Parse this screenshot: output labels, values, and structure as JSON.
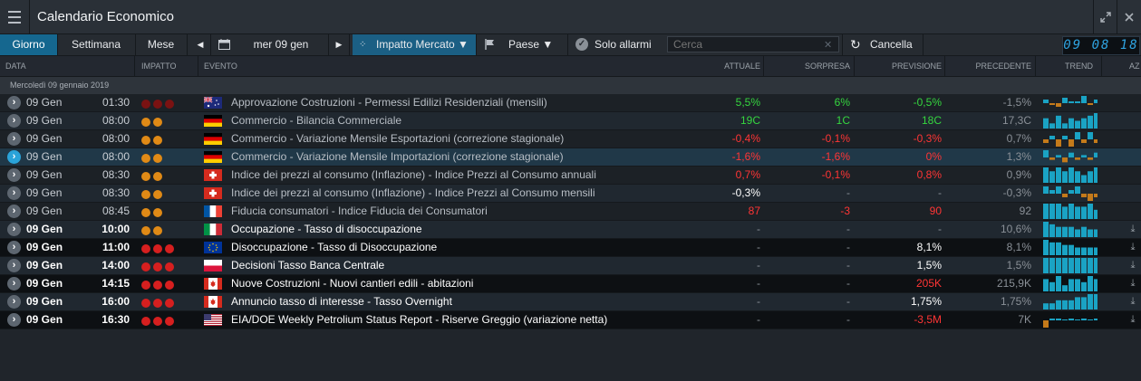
{
  "app": {
    "title": "Calendario Economico",
    "expand_icon": "expand-icon",
    "close_icon": "close-icon"
  },
  "toolbar": {
    "tab_day": "Giorno",
    "tab_week": "Settimana",
    "tab_month": "Mese",
    "date": "mer 09 gen",
    "impact_filter": "Impatto Mercato ▼",
    "country_filter": "Paese ▼",
    "alarms_only": "Solo allarmi",
    "search_placeholder": "Cerca",
    "clear": "Cancella",
    "clock": "09 08 18"
  },
  "headers": {
    "data": "DATA",
    "impatto": "IMPATTO",
    "evento": "EVENTO",
    "attuale": "ATTUALE",
    "sorpresa": "SORPRESA",
    "previsione": "PREVISIONE",
    "precedente": "PRECEDENTE",
    "trend": "TREND",
    "az": "AZ"
  },
  "date_group": "Mercoledì 09 gennaio 2019",
  "colors": {
    "accent": "#15678f",
    "impact_red": "#d61f1f",
    "impact_dark_red": "#7a1212",
    "impact_orange": "#e08a16",
    "positive": "#35d63f",
    "negative": "#ff3535",
    "trend_blue": "#1aa3c4",
    "trend_orange": "#c47a1a"
  },
  "events": [
    {
      "date": "09 Gen",
      "time": "01:30",
      "impact": 3,
      "impact_style": "dark",
      "flag": "australia",
      "event": "Approvazione Costruzioni - Permessi Edilizi Residenziali (mensili)",
      "actual": "5,5%",
      "actual_color": "green",
      "surprise": "6%",
      "surprise_color": "green",
      "forecast": "-0,5%",
      "forecast_color": "green",
      "previous": "-1,5%",
      "bars": [
        2,
        -1,
        -2,
        3,
        1,
        1,
        4,
        -1,
        2
      ],
      "style": "odd",
      "bold": false
    },
    {
      "date": "09 Gen",
      "time": "08:00",
      "impact": 2,
      "impact_style": "orange",
      "flag": "germany",
      "event": "Commercio - Bilancia Commerciale",
      "actual": "19C",
      "actual_color": "green",
      "surprise": "1C",
      "surprise_color": "green",
      "forecast": "18C",
      "forecast_color": "green",
      "previous": "17,3C",
      "bars": [
        4,
        2,
        5,
        2,
        4,
        3,
        4,
        5,
        6
      ],
      "style": "even",
      "bold": false
    },
    {
      "date": "09 Gen",
      "time": "08:00",
      "impact": 2,
      "impact_style": "orange",
      "flag": "germany",
      "event": "Commercio - Variazione Mensile Esportazioni (correzione stagionale)",
      "actual": "-0,4%",
      "actual_color": "red",
      "surprise": "-0,1%",
      "surprise_color": "red",
      "forecast": "-0,3%",
      "forecast_color": "red",
      "previous": "0,7%",
      "bars": [
        -1,
        1,
        -2,
        1,
        -2,
        2,
        -1,
        2,
        -1
      ],
      "style": "odd",
      "bold": false
    },
    {
      "date": "09 Gen",
      "time": "08:00",
      "impact": 2,
      "impact_style": "orange",
      "flag": "germany",
      "event": "Commercio - Variazione Mensile Importazioni (correzione stagionale)",
      "actual": "-1,6%",
      "actual_color": "red",
      "surprise": "-1,6%",
      "surprise_color": "red",
      "forecast": "0%",
      "forecast_color": "red",
      "previous": "1,3%",
      "bars": [
        3,
        -1,
        1,
        -2,
        2,
        -1,
        1,
        -1,
        2
      ],
      "style": "hl",
      "bold": false
    },
    {
      "date": "09 Gen",
      "time": "08:30",
      "impact": 2,
      "impact_style": "orange",
      "flag": "switzerland",
      "event": "Indice dei prezzi al consumo (Inflazione) - Indice Prezzi al Consumo annuali",
      "actual": "0,7%",
      "actual_color": "red",
      "surprise": "-0,1%",
      "surprise_color": "red",
      "forecast": "0,8%",
      "forecast_color": "red",
      "previous": "0,9%",
      "bars": [
        4,
        3,
        4,
        3,
        4,
        3,
        2,
        3,
        4
      ],
      "style": "odd",
      "bold": false
    },
    {
      "date": "09 Gen",
      "time": "08:30",
      "impact": 2,
      "impact_style": "orange",
      "flag": "switzerland",
      "event": "Indice dei prezzi al consumo (Inflazione) - Indice Prezzi al Consumo mensili",
      "actual": "-0,3%",
      "actual_color": "white",
      "surprise": "-",
      "surprise_color": "grey",
      "forecast": "-",
      "forecast_color": "grey",
      "previous": "-0,3%",
      "bars": [
        2,
        1,
        2,
        -1,
        1,
        2,
        -1,
        -2,
        -1
      ],
      "style": "even",
      "bold": false
    },
    {
      "date": "09 Gen",
      "time": "08:45",
      "impact": 2,
      "impact_style": "orange",
      "flag": "france",
      "event": "Fiducia consumatori - Indice Fiducia dei Consumatori",
      "actual": "87",
      "actual_color": "red",
      "surprise": "-3",
      "surprise_color": "red",
      "forecast": "90",
      "forecast_color": "red",
      "previous": "92",
      "bars": [
        5,
        5,
        5,
        4,
        5,
        4,
        4,
        5,
        3
      ],
      "style": "odd",
      "bold": false
    },
    {
      "date": "09 Gen",
      "time": "10:00",
      "impact": 2,
      "impact_style": "orange",
      "flag": "italy",
      "event": "Occupazione - Tasso di disoccupazione",
      "actual": "-",
      "actual_color": "grey",
      "surprise": "-",
      "surprise_color": "grey",
      "forecast": "-",
      "forecast_color": "grey",
      "previous": "10,6%",
      "bars": [
        6,
        5,
        4,
        4,
        4,
        3,
        4,
        3,
        3
      ],
      "style": "even",
      "bold": true
    },
    {
      "date": "09 Gen",
      "time": "11:00",
      "impact": 3,
      "impact_style": "red",
      "flag": "eu",
      "event": "Disoccupazione - Tasso di Disoccupazione",
      "actual": "-",
      "actual_color": "grey",
      "surprise": "-",
      "surprise_color": "grey",
      "forecast": "8,1%",
      "forecast_color": "white",
      "previous": "8,1%",
      "bars": [
        6,
        5,
        5,
        4,
        4,
        3,
        3,
        3,
        3
      ],
      "style": "black",
      "bold": true
    },
    {
      "date": "09 Gen",
      "time": "14:00",
      "impact": 3,
      "impact_style": "red",
      "flag": "poland",
      "event": "Decisioni Tasso Banca Centrale",
      "actual": "-",
      "actual_color": "grey",
      "surprise": "-",
      "surprise_color": "grey",
      "forecast": "1,5%",
      "forecast_color": "white",
      "previous": "1,5%",
      "bars": [
        1,
        1,
        1,
        1,
        1,
        1,
        1,
        1,
        1
      ],
      "style": "even",
      "bold": true
    },
    {
      "date": "09 Gen",
      "time": "14:15",
      "impact": 3,
      "impact_style": "red",
      "flag": "canada",
      "event": "Nuove Costruzioni - Nuovi cantieri edili - abitazioni",
      "actual": "-",
      "actual_color": "grey",
      "surprise": "-",
      "surprise_color": "grey",
      "forecast": "205K",
      "forecast_color": "red",
      "previous": "215,9K",
      "bars": [
        4,
        3,
        5,
        2,
        4,
        4,
        3,
        5,
        4
      ],
      "style": "black",
      "bold": true
    },
    {
      "date": "09 Gen",
      "time": "16:00",
      "impact": 3,
      "impact_style": "red",
      "flag": "canada",
      "event": "Annuncio tasso di interesse - Tasso Overnight",
      "actual": "-",
      "actual_color": "grey",
      "surprise": "-",
      "surprise_color": "grey",
      "forecast": "1,75%",
      "forecast_color": "white",
      "previous": "1,75%",
      "bars": [
        2,
        2,
        3,
        3,
        3,
        4,
        4,
        5,
        5
      ],
      "style": "even",
      "bold": true
    },
    {
      "date": "09 Gen",
      "time": "16:30",
      "impact": 3,
      "impact_style": "red",
      "flag": "usa",
      "event": "EIA/DOE Weekly Petrolium Status Report - Riserve Greggio (variazione netta)",
      "actual": "-",
      "actual_color": "grey",
      "surprise": "-",
      "surprise_color": "grey",
      "forecast": "-3,5M",
      "forecast_color": "red",
      "previous": "7K",
      "bars": [
        -4,
        1,
        1,
        0,
        1,
        0,
        1,
        0,
        1
      ],
      "style": "black",
      "bold": true
    }
  ]
}
